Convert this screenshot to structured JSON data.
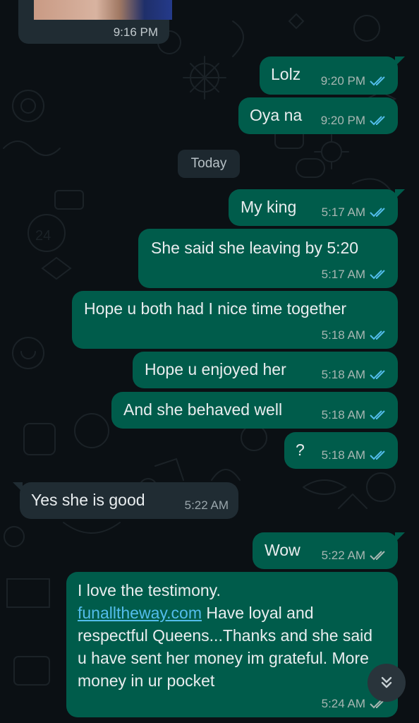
{
  "colors": {
    "background": "#0b1014",
    "outgoing_bubble": "#005c4b",
    "incoming_bubble": "#202c33",
    "read_tick": "#53bdeb",
    "sent_tick": "#a8b7b3",
    "link": "#53bdeb"
  },
  "top_image": {
    "time": "9:16 PM",
    "icon": "photo-thumbnail"
  },
  "date_separator": "Today",
  "messages": [
    {
      "text": "Lolz",
      "time": "9:20 PM",
      "status": "read"
    },
    {
      "text": "Oya na",
      "time": "9:20 PM",
      "status": "read"
    },
    {
      "text": "My king",
      "time": "5:17 AM",
      "status": "read"
    },
    {
      "text": "She said she leaving by 5:20",
      "time": "5:17 AM",
      "status": "read"
    },
    {
      "text": "Hope u both had I nice time together",
      "time": "5:18 AM",
      "status": "read"
    },
    {
      "text": "Hope u enjoyed her",
      "time": "5:18 AM",
      "status": "read"
    },
    {
      "text": "And she behaved well",
      "time": "5:18 AM",
      "status": "read"
    },
    {
      "text": "?",
      "time": "5:18 AM",
      "status": "read"
    },
    {
      "text": "Yes she is good",
      "time": "5:22 AM",
      "direction": "incoming"
    },
    {
      "text": "Wow",
      "time": "5:22 AM",
      "status": "delivered"
    }
  ],
  "last_message": {
    "before_link": "I love the testimony.",
    "link": "funalltheway.com",
    "after_link": " Have loyal and respectful Queens...Thanks and she said u have sent her money im grateful. More money in ur pocket",
    "time": "5:24 AM",
    "status": "delivered"
  },
  "scroll_button": {
    "icon": "double-chevron-down-icon"
  }
}
